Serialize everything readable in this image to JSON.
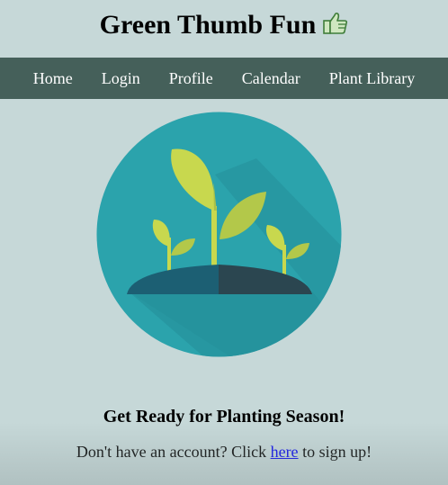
{
  "header": {
    "title": "Green Thumb Fun",
    "title_icon": "thumbs-up-icon"
  },
  "nav": {
    "items": [
      {
        "label": "Home"
      },
      {
        "label": "Login"
      },
      {
        "label": "Profile"
      },
      {
        "label": "Calendar"
      },
      {
        "label": "Plant Library"
      }
    ]
  },
  "hero": {
    "image": "sprouting-plants-illustration"
  },
  "main": {
    "tagline": "Get Ready for Planting Season!",
    "signup_prefix": "Don't have an account? Click ",
    "signup_link": "here",
    "signup_suffix": " to sign up!"
  },
  "colors": {
    "background": "#c6d8d8",
    "nav_bar": "#45605a",
    "hero_circle": "#2ba3ac",
    "leaf_light": "#c8d84e",
    "leaf_shade": "#a9c04a",
    "soil_left": "#1c5f73",
    "soil_right": "#2b4650",
    "link": "#0000ee"
  }
}
